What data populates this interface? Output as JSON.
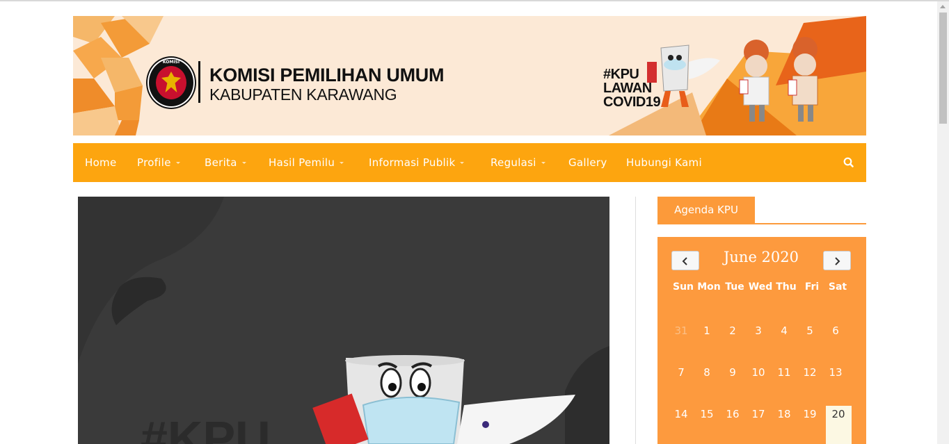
{
  "header": {
    "title_line1": "KOMISI PEMILIHAN UMUM",
    "title_line2": "KABUPATEN KARAWANG",
    "logo_text": "KOMISI",
    "campaign": [
      "#KPU",
      "LAWAN",
      "COVID19"
    ]
  },
  "nav": {
    "items": [
      {
        "label": "Home",
        "dropdown": false
      },
      {
        "label": "Profile",
        "dropdown": true
      },
      {
        "label": "Berita",
        "dropdown": true
      },
      {
        "label": "Hasil Pemilu",
        "dropdown": true
      },
      {
        "label": "Informasi Publik",
        "dropdown": true
      },
      {
        "label": "Regulasi",
        "dropdown": true
      },
      {
        "label": "Gallery",
        "dropdown": false
      },
      {
        "label": "Hubungi Kami",
        "dropdown": false
      }
    ],
    "search_icon": "search-icon"
  },
  "sidebar": {
    "tab_label": "Agenda KPU",
    "calendar": {
      "month_label": "June 2020",
      "weekdays": [
        "Sun",
        "Mon",
        "Tue",
        "Wed",
        "Thu",
        "Fri",
        "Sat"
      ],
      "weeks": [
        [
          "31",
          "1",
          "2",
          "3",
          "4",
          "5",
          "6"
        ],
        [
          "7",
          "8",
          "9",
          "10",
          "11",
          "12",
          "13"
        ],
        [
          "14",
          "15",
          "16",
          "17",
          "18",
          "19",
          "20"
        ]
      ],
      "today": "20",
      "prev_icon": "chevron-left-icon",
      "next_icon": "chevron-right-icon"
    }
  },
  "colors": {
    "brand_orange": "#fda50f",
    "calendar_orange": "#fd9a3e",
    "banner_bg": "#fce9d6"
  }
}
